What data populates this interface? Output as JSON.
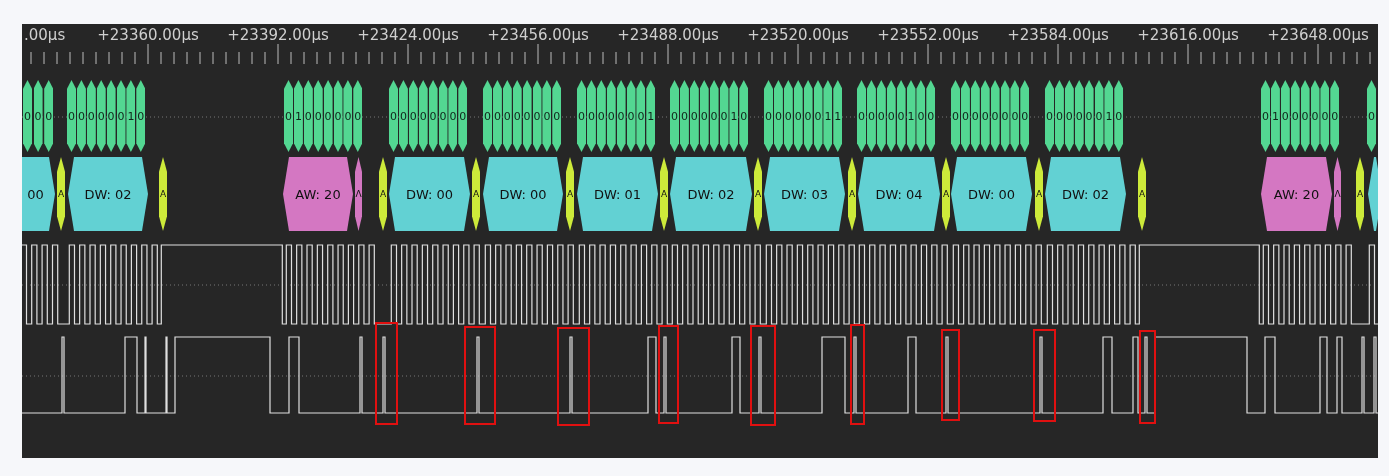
{
  "ruler": {
    "labels": [
      ".00µs",
      "+23360.00µs",
      "+23392.00µs",
      "+23424.00µs",
      "+23456.00µs",
      "+23488.00µs",
      "+23520.00µs",
      "+23552.00µs",
      "+23584.00µs",
      "+23616.00µs",
      "+23648.00µs"
    ]
  },
  "bit_row": {
    "groups": [
      {
        "bits": [
          "0",
          "0",
          "0"
        ]
      },
      {
        "bits": [
          "0",
          "0",
          "0",
          "0",
          "0",
          "0",
          "1",
          "0"
        ]
      },
      {
        "bits": [
          "0",
          "1",
          "0",
          "0",
          "0",
          "0",
          "0",
          "0"
        ]
      },
      {
        "bits": [
          "0",
          "0",
          "0",
          "0",
          "0",
          "0",
          "0",
          "0"
        ]
      },
      {
        "bits": [
          "0",
          "0",
          "0",
          "0",
          "0",
          "0",
          "0",
          "0"
        ]
      },
      {
        "bits": [
          "0",
          "0",
          "0",
          "0",
          "0",
          "0",
          "0",
          "1"
        ]
      },
      {
        "bits": [
          "0",
          "0",
          "0",
          "0",
          "0",
          "0",
          "1",
          "0"
        ]
      },
      {
        "bits": [
          "0",
          "0",
          "0",
          "0",
          "0",
          "0",
          "1",
          "1"
        ]
      },
      {
        "bits": [
          "0",
          "0",
          "0",
          "0",
          "0",
          "1",
          "0",
          "0"
        ]
      },
      {
        "bits": [
          "0",
          "0",
          "0",
          "0",
          "0",
          "0",
          "0",
          "0"
        ]
      },
      {
        "bits": [
          "0",
          "0",
          "0",
          "0",
          "0",
          "0",
          "1",
          "0"
        ]
      },
      {
        "bits": [
          "0",
          "1",
          "0",
          "0",
          "0",
          "0",
          "0",
          "0"
        ]
      },
      {
        "bits": [
          "0"
        ]
      }
    ]
  },
  "word_row": {
    "items": [
      {
        "kind": "data",
        "text": "00"
      },
      {
        "kind": "ack",
        "text": "A"
      },
      {
        "kind": "data",
        "text": "DW: 02"
      },
      {
        "kind": "ack",
        "text": "A"
      },
      {
        "kind": "address",
        "text": "AW: 20"
      },
      {
        "kind": "rw",
        "text": "Λ"
      },
      {
        "kind": "ack",
        "text": "A"
      },
      {
        "kind": "data",
        "text": "DW: 00"
      },
      {
        "kind": "ack",
        "text": "A"
      },
      {
        "kind": "data",
        "text": "DW: 00"
      },
      {
        "kind": "ack",
        "text": "A"
      },
      {
        "kind": "data",
        "text": "DW: 01"
      },
      {
        "kind": "ack",
        "text": "A"
      },
      {
        "kind": "data",
        "text": "DW: 02"
      },
      {
        "kind": "ack",
        "text": "A"
      },
      {
        "kind": "data",
        "text": "DW: 03"
      },
      {
        "kind": "ack",
        "text": "A"
      },
      {
        "kind": "data",
        "text": "DW: 04"
      },
      {
        "kind": "ack",
        "text": "A"
      },
      {
        "kind": "data",
        "text": "DW: 00"
      },
      {
        "kind": "ack",
        "text": "A"
      },
      {
        "kind": "data",
        "text": "DW: 02"
      },
      {
        "kind": "ack",
        "text": "A"
      },
      {
        "kind": "address",
        "text": "AW: 20"
      },
      {
        "kind": "rw",
        "text": "Λ"
      },
      {
        "kind": "ack",
        "text": "A"
      },
      {
        "kind": "data"
      }
    ]
  }
}
